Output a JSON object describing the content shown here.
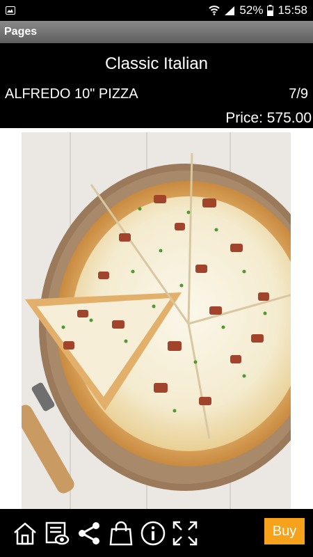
{
  "statusbar": {
    "battery": "52%",
    "time": "15:58"
  },
  "appbar": {
    "title": "Pages"
  },
  "product": {
    "category": "Classic Italian",
    "name": "ALFREDO 10\" PIZZA",
    "page_indicator": "7/9",
    "price": "Price: 575.00"
  },
  "toolbar": {
    "buy_label": "Buy"
  },
  "colors": {
    "accent": "#f7a21b",
    "appbar": "#6e6e6e",
    "background": "#000000"
  },
  "icons": [
    "home-icon",
    "catalog-view-icon",
    "share-icon",
    "shopping-bag-icon",
    "info-icon",
    "fullscreen-icon"
  ]
}
